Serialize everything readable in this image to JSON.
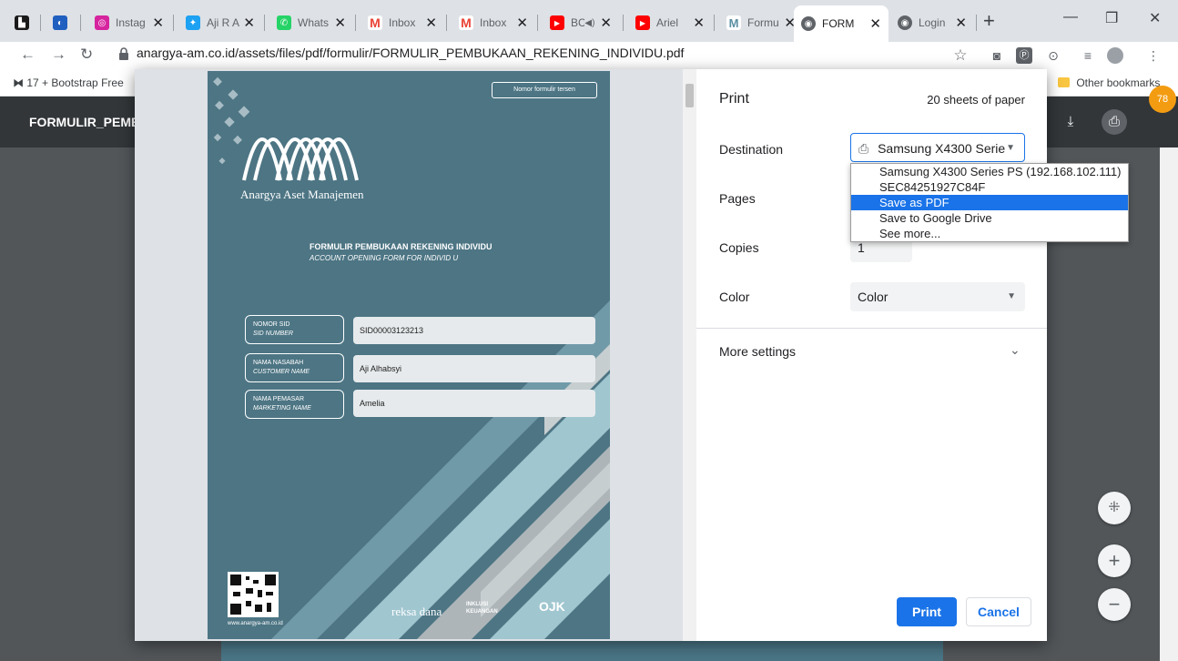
{
  "tabs": [
    {
      "title": "",
      "favicon_color": "#1a1a1a",
      "glyph": "▙"
    },
    {
      "title": "",
      "favicon_color": "#1f5fbf",
      "glyph": "◐"
    },
    {
      "title": "Instag",
      "favicon_color": "#d6249f",
      "glyph": "◎"
    },
    {
      "title": "Aji R A",
      "favicon_color": "#1da1f2",
      "glyph": "✦"
    },
    {
      "title": "Whats",
      "favicon_color": "#25d366",
      "glyph": "✆"
    },
    {
      "title": "Inbox",
      "favicon_color": "#ea4335",
      "glyph": "M"
    },
    {
      "title": "Inbox",
      "favicon_color": "#ea4335",
      "glyph": "M"
    },
    {
      "title": "BC",
      "favicon_color": "#ff0000",
      "glyph": "▶"
    },
    {
      "title": "Ariel",
      "favicon_color": "#ff0000",
      "glyph": "▶"
    },
    {
      "title": "Formu",
      "favicon_color": "#5b8fa3",
      "glyph": "M"
    },
    {
      "title": "FORM",
      "favicon_color": "#5f6368",
      "glyph": "◉"
    },
    {
      "title": "Login",
      "favicon_color": "#5f6368",
      "glyph": "◉"
    }
  ],
  "address": {
    "url": "anargya-am.co.id/assets/files/pdf/formulir/FORMULIR_PEMBUKAAN_REKENING_INDIVIDU.pdf"
  },
  "bookmarks": {
    "first": "17 + Bootstrap Free",
    "other": "Other bookmarks"
  },
  "badge_count": "78",
  "pdf_viewer": {
    "title": "FORMULIR_PEMBU"
  },
  "print": {
    "title": "Print",
    "sheets": "20 sheets of paper",
    "destination_label": "Destination",
    "destination_value": "Samsung X4300 Serie",
    "destination_options": [
      "Samsung X4300 Series PS (192.168.102.111)",
      "SEC84251927C84F",
      "Save as PDF",
      "Save to Google Drive",
      "See more..."
    ],
    "selected_option": "Save as PDF",
    "pages_label": "Pages",
    "copies_label": "Copies",
    "copies_value": "1",
    "color_label": "Color",
    "color_value": "Color",
    "more_settings": "More settings",
    "print_button": "Print",
    "cancel_button": "Cancel"
  },
  "document": {
    "form_number": "Nomor formulir tersen",
    "company": "Anargya Aset Manajemen",
    "heading": "FORMULIR PEMBUKAAN REKENING INDIVIDU",
    "subheading": "ACCOUNT OPENING FORM FOR INDIVID U",
    "fields": [
      {
        "label": "NOMOR SID",
        "label_en": "SID NUMBER",
        "value": "SID00003123213"
      },
      {
        "label": "NAMA NASABAH",
        "label_en": "CUSTOMER NAME",
        "value": "Aji Alhabsyi"
      },
      {
        "label": "NAMA PEMASAR",
        "label_en": "MARKETING NAME",
        "value": "Amelia"
      }
    ],
    "website": "www.anargya-am.co.id",
    "footer_logos": [
      "reksa dana",
      "INKLUSI KEUANGAN",
      "OJK"
    ]
  }
}
